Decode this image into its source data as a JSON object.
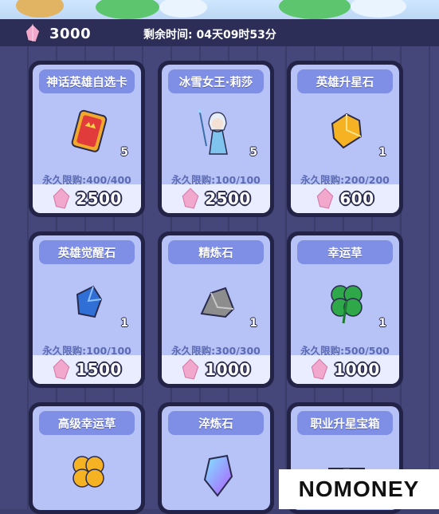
{
  "header": {
    "currency_amount": "3000",
    "timer_text": "剩余时间: 04天09时53分"
  },
  "colors": {
    "card_bg": "#b7c3f7",
    "title_bg": "#7f8fe6",
    "gem": "#f2a7cc",
    "frame": "#222347"
  },
  "items": [
    {
      "title": "神话英雄自选卡",
      "qty": "5",
      "limit": "永久限购:400/400",
      "price": "2500",
      "icon": "red-card-icon"
    },
    {
      "title": "冰雪女王·莉莎",
      "qty": "5",
      "limit": "永久限购:100/100",
      "price": "2500",
      "icon": "ice-queen-icon"
    },
    {
      "title": "英雄升星石",
      "qty": "1",
      "limit": "永久限购:200/200",
      "price": "600",
      "icon": "star-stone-icon"
    },
    {
      "title": "英雄觉醒石",
      "qty": "1",
      "limit": "永久限购:100/100",
      "price": "1500",
      "icon": "blue-gem-icon"
    },
    {
      "title": "精炼石",
      "qty": "1",
      "limit": "永久限购:300/300",
      "price": "1000",
      "icon": "grey-rock-icon"
    },
    {
      "title": "幸运草",
      "qty": "1",
      "limit": "永久限购:500/500",
      "price": "1000",
      "icon": "clover-icon"
    },
    {
      "title": "高级幸运草",
      "icon": "gold-clover-icon"
    },
    {
      "title": "淬炼石",
      "icon": "crystal-icon"
    },
    {
      "title": "职业升星宝箱",
      "icon": "chest-icon"
    }
  ],
  "watermark": {
    "brand": "NOMONEY"
  }
}
